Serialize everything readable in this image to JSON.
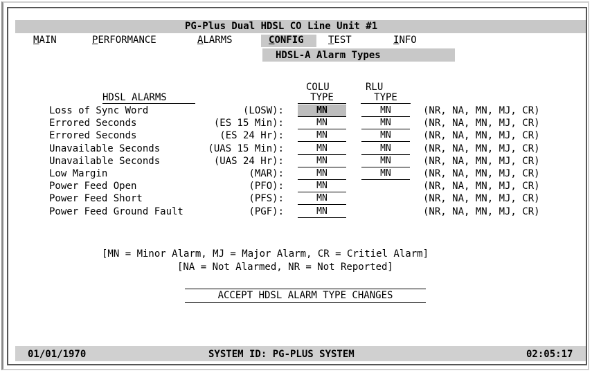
{
  "title": "PG-Plus Dual HDSL CO Line Unit #1",
  "menu": [
    {
      "hot": "M",
      "rest": "AIN"
    },
    {
      "hot": "P",
      "rest": "ERFORMANCE"
    },
    {
      "hot": "A",
      "rest": "LARMS"
    },
    {
      "hot": "C",
      "rest": "ONFIG"
    },
    {
      "hot": "T",
      "rest": "EST"
    },
    {
      "hot": "I",
      "rest": "NFO"
    }
  ],
  "active_menu": "CONFIG",
  "subtitle": "HDSL-A Alarm Types",
  "headers": {
    "section": "HDSL ALARMS",
    "colu_1": "COLU",
    "colu_2": "TYPE",
    "rlu_1": "RLU",
    "rlu_2": "TYPE"
  },
  "rows": [
    {
      "label": "Loss of Sync Word",
      "code": "(LOSW):",
      "colu": "MN",
      "rlu": "MN",
      "opts": "(NR, NA, MN, MJ, CR)"
    },
    {
      "label": "Errored Seconds",
      "code": "(ES 15 Min):",
      "colu": "MN",
      "rlu": "MN",
      "opts": "(NR, NA, MN, MJ, CR)"
    },
    {
      "label": "Errored Seconds",
      "code": "(ES 24 Hr):",
      "colu": "MN",
      "rlu": "MN",
      "opts": "(NR, NA, MN, MJ, CR)"
    },
    {
      "label": "Unavailable Seconds",
      "code": "(UAS 15 Min):",
      "colu": "MN",
      "rlu": "MN",
      "opts": "(NR, NA, MN, MJ, CR)"
    },
    {
      "label": "Unavailable Seconds",
      "code": "(UAS 24 Hr):",
      "colu": "MN",
      "rlu": "MN",
      "opts": "(NR, NA, MN, MJ, CR)"
    },
    {
      "label": "Low Margin",
      "code": "(MAR):",
      "colu": "MN",
      "rlu": "MN",
      "opts": "(NR, NA, MN, MJ, CR)"
    },
    {
      "label": "Power Feed Open",
      "code": "(PFO):",
      "colu": "MN",
      "rlu": "",
      "opts": "(NR, NA, MN, MJ, CR)"
    },
    {
      "label": "Power Feed Short",
      "code": "(PFS):",
      "colu": "MN",
      "rlu": "",
      "opts": "(NR, NA, MN, MJ, CR)"
    },
    {
      "label": "Power Feed Ground Fault",
      "code": "(PGF):",
      "colu": "MN",
      "rlu": "",
      "opts": "(NR, NA, MN, MJ, CR)"
    }
  ],
  "legend_1": "[MN = Minor Alarm, MJ = Major Alarm, CR = Critiel Alarm]",
  "legend_2": "[NA = Not Alarmed, NR = Not Reported]",
  "accept_label": "ACCEPT HDSL ALARM TYPE CHANGES",
  "status": {
    "date": "01/01/1970",
    "system_id": "SYSTEM ID: PG-PLUS SYSTEM",
    "time": "02:05:17"
  },
  "colors": {
    "bar_gray": "#c8c8c8",
    "selected_field": "#bdbdbd"
  }
}
